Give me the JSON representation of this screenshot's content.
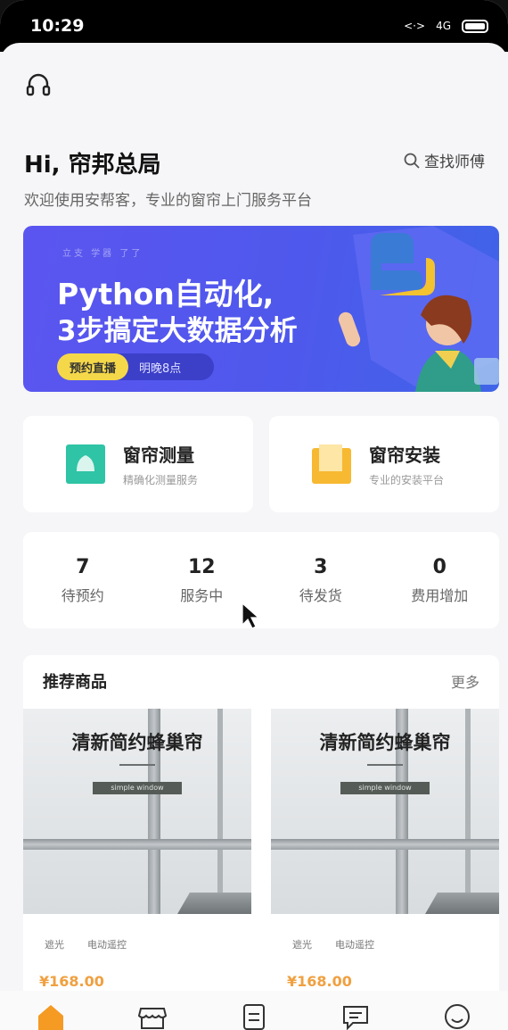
{
  "status_bar": {
    "time": "10:29",
    "network": "4G"
  },
  "header": {
    "greeting": "Hi, 帘邦总局",
    "subtitle": "欢迎使用安帮客，专业的窗帘上门服务平台",
    "find_master_label": "查找师傅"
  },
  "banner": {
    "dots_text": "立支 学器 了了",
    "line1": "Python自动化,",
    "line2": "3步搞定大数据分析",
    "primary_pill": "预约直播",
    "secondary_pill": "明晚8点"
  },
  "services": [
    {
      "title": "窗帘测量",
      "desc": "精确化测量服务",
      "icon": "measure-icon",
      "color": "#2ec4a5"
    },
    {
      "title": "窗帘安装",
      "desc": "专业的安装平台",
      "icon": "install-icon",
      "color": "#f7b932"
    }
  ],
  "stats": [
    {
      "value": "7",
      "label": "待预约"
    },
    {
      "value": "12",
      "label": "服务中"
    },
    {
      "value": "3",
      "label": "待发货"
    },
    {
      "value": "0",
      "label": "费用增加"
    }
  ],
  "recommend": {
    "title": "推荐商品",
    "more_label": "更多",
    "products": [
      {
        "title": "清新简约蜂巢帘",
        "tag": "simple window",
        "chips": [
          "遮光",
          "电动遥控"
        ],
        "price": "¥168.00"
      },
      {
        "title": "清新简约蜂巢帘",
        "tag": "simple window",
        "chips": [
          "遮光",
          "电动遥控"
        ],
        "price": "¥168.00"
      }
    ]
  },
  "tabbar": {
    "tabs": [
      {
        "icon": "home-icon",
        "active": true
      },
      {
        "icon": "store-icon",
        "active": false
      },
      {
        "icon": "orders-icon",
        "active": false
      },
      {
        "icon": "message-icon",
        "active": false
      },
      {
        "icon": "profile-icon",
        "active": false
      }
    ],
    "accent": "#f59a23"
  }
}
